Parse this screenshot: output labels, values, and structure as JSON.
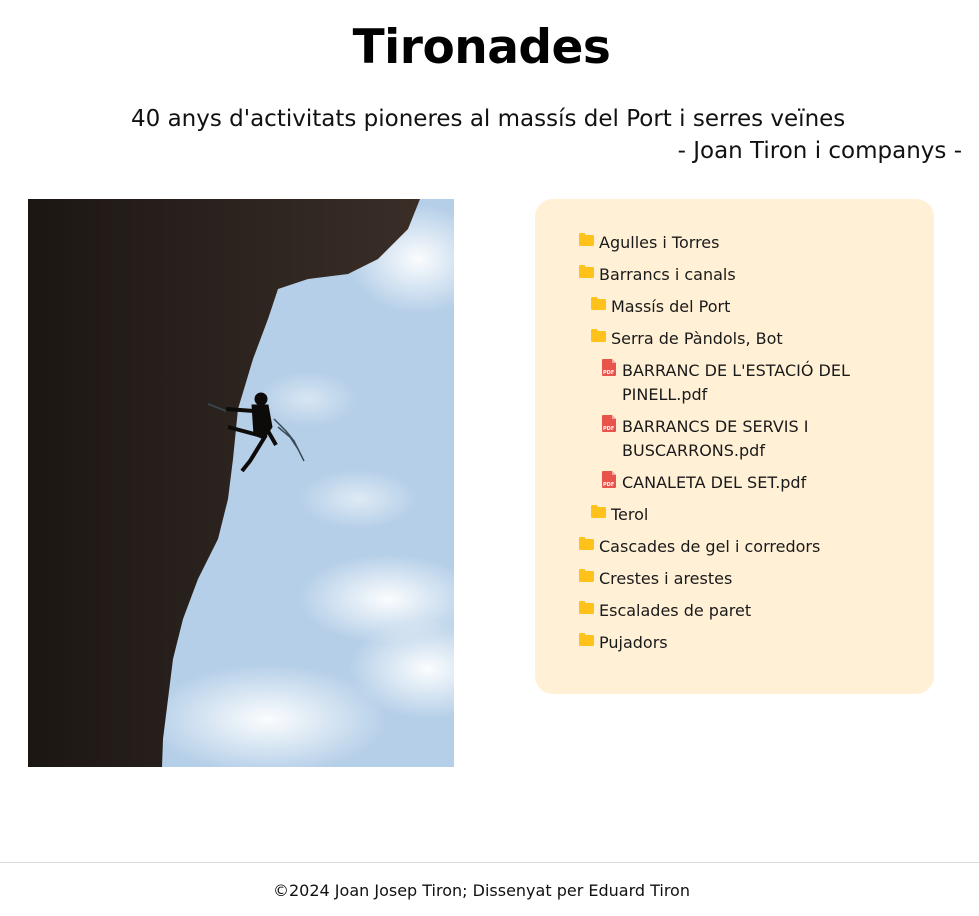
{
  "header": {
    "title": "Tironades",
    "subtitle": "40 anys d'activitats pioneres al massís del Port i serres veïnes",
    "author": "- Joan Tiron i companys -"
  },
  "tree": {
    "items": [
      {
        "label": "Agulles i Torres",
        "type": "folder",
        "icon": "folder-icon"
      },
      {
        "label": "Barrancs i canals",
        "type": "folder",
        "icon": "folder-icon"
      },
      {
        "label": "Massís del Port",
        "type": "folder",
        "icon": "folder-icon"
      },
      {
        "label": "Serra de Pàndols, Bot",
        "type": "folder",
        "icon": "folder-icon"
      },
      {
        "label": "BARRANC DE L'ESTACIÓ DEL PINELL.pdf",
        "type": "pdf",
        "icon": "pdf-icon"
      },
      {
        "label": "BARRANCS DE SERVIS I BUSCARRONS.pdf",
        "type": "pdf",
        "icon": "pdf-icon"
      },
      {
        "label": "CANALETA DEL SET.pdf",
        "type": "pdf",
        "icon": "pdf-icon"
      },
      {
        "label": "Terol",
        "type": "folder",
        "icon": "folder-icon"
      },
      {
        "label": "Cascades de gel i corredors",
        "type": "folder",
        "icon": "folder-icon"
      },
      {
        "label": "Crestes i arestes",
        "type": "folder",
        "icon": "folder-icon"
      },
      {
        "label": "Escalades de paret",
        "type": "folder",
        "icon": "folder-icon"
      },
      {
        "label": "Pujadors",
        "type": "folder",
        "icon": "folder-icon"
      }
    ]
  },
  "footer": {
    "text": "©2024 Joan Josep Tiron; Dissenyat per Eduard Tiron"
  },
  "colors": {
    "panel_bg": "#fff0d6",
    "folder": "#ffc21a",
    "pdf": "#e8534a"
  }
}
